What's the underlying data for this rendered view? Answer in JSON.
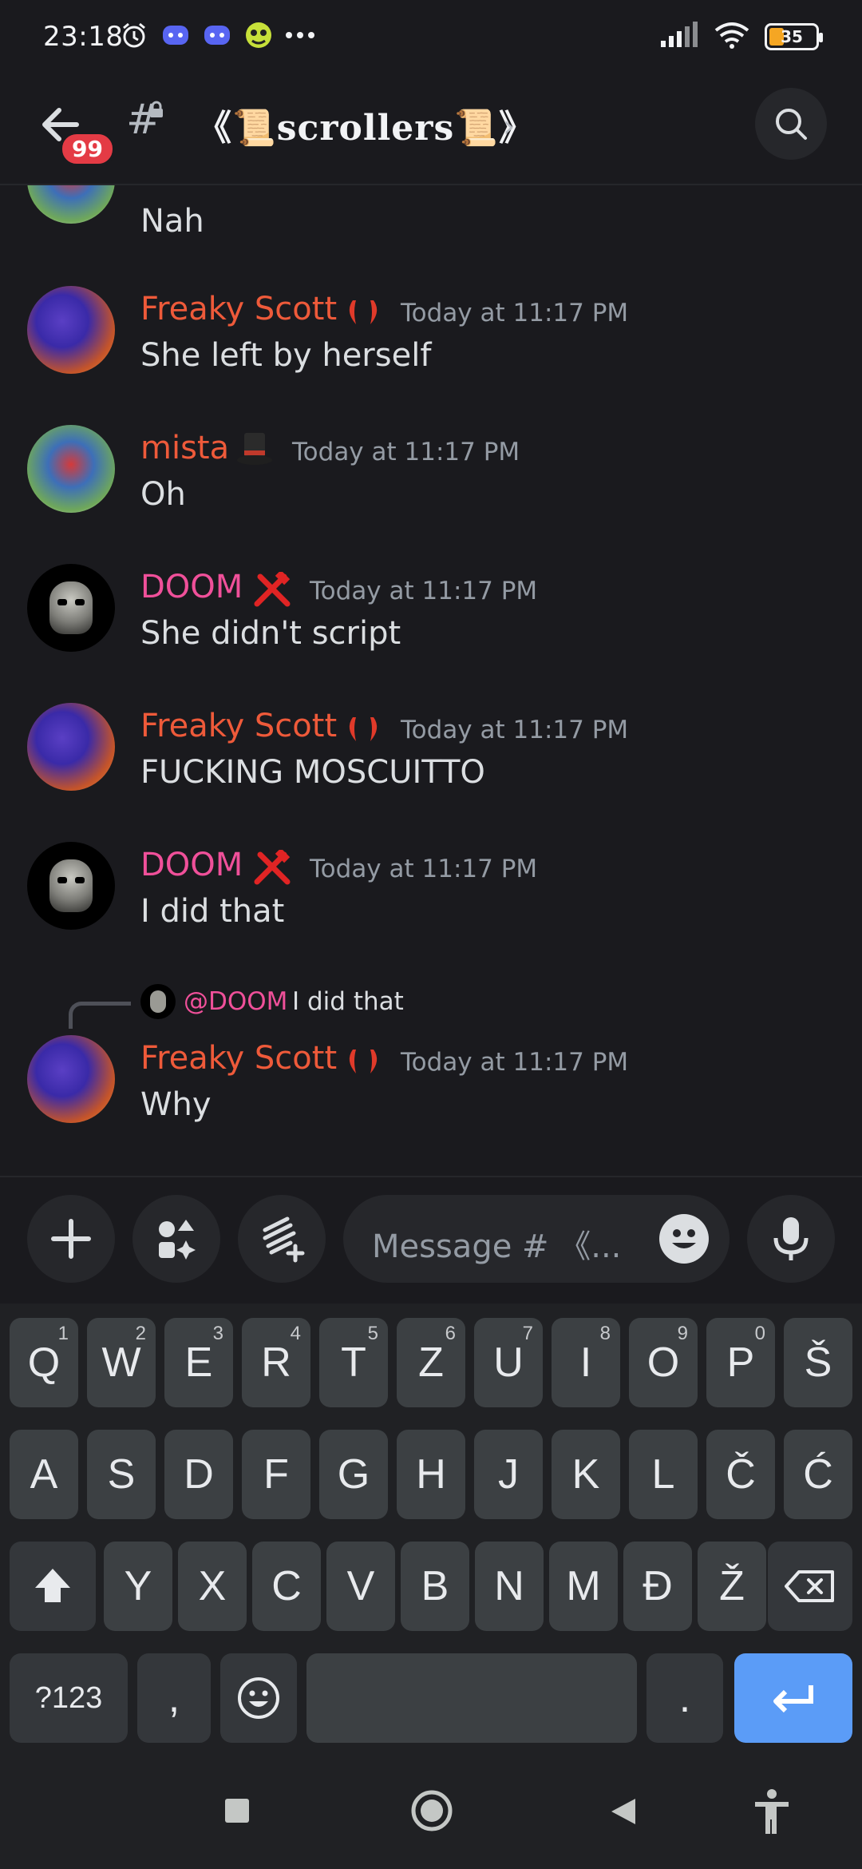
{
  "status_bar": {
    "time": "23:18",
    "battery": "35"
  },
  "header": {
    "badge_count": "99",
    "channel_name": "《📜scrollers📜》",
    "chevron": "›"
  },
  "messages": [
    {
      "text": "Nah"
    },
    {
      "author": "Freaky Scott",
      "time": "Today at 11:17 PM",
      "text": "She left by herself"
    },
    {
      "author": "mista",
      "time": "Today at 11:17 PM",
      "text": "Oh"
    },
    {
      "author": "DOOM",
      "time": "Today at 11:17 PM",
      "text": "She didn't script"
    },
    {
      "author": "Freaky Scott",
      "time": "Today at 11:17 PM",
      "text": "FUCKING MOSCUITTO"
    },
    {
      "author": "DOOM",
      "time": "Today at 11:17 PM",
      "text": "I did that"
    },
    {
      "author": "Freaky Scott",
      "time": "Today at 11:17 PM",
      "text": "Why",
      "reply": {
        "mention": "@DOOM",
        "text": "I did that"
      }
    }
  ],
  "input": {
    "placeholder": "Message # 《..."
  },
  "keyboard": {
    "row1": [
      "Q",
      "W",
      "E",
      "R",
      "T",
      "Z",
      "U",
      "I",
      "O",
      "P",
      "Š"
    ],
    "row1_hints": [
      "1",
      "2",
      "3",
      "4",
      "5",
      "6",
      "7",
      "8",
      "9",
      "0",
      ""
    ],
    "row2": [
      "A",
      "S",
      "D",
      "F",
      "G",
      "H",
      "J",
      "K",
      "L",
      "Č",
      "Ć"
    ],
    "row3": [
      "Y",
      "X",
      "C",
      "V",
      "B",
      "N",
      "M",
      "Đ",
      "Ž"
    ],
    "symbols_key": "?123",
    "comma": ",",
    "period": "."
  },
  "colors": {
    "background": "#1a1a1e",
    "name_scott": "#ee5a3a",
    "name_doom": "#f0509a",
    "enter_key": "#5b9cf7"
  }
}
